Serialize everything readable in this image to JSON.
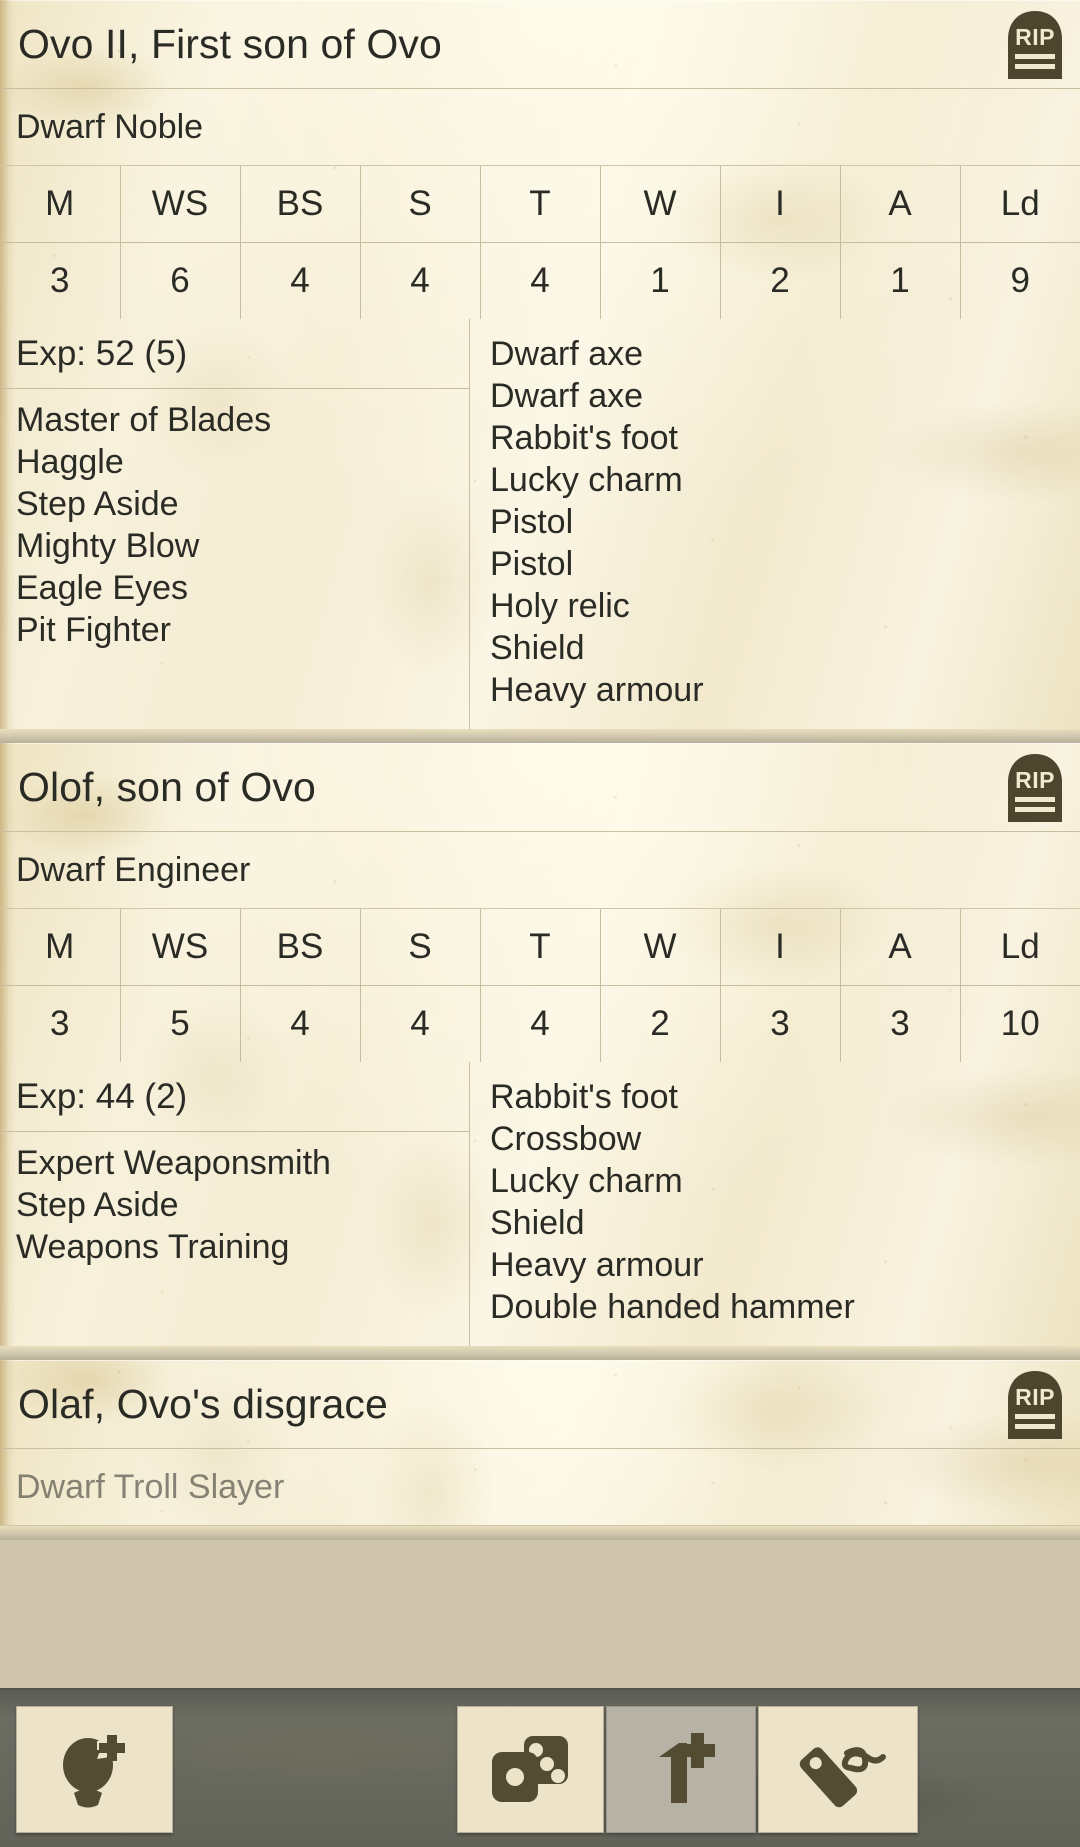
{
  "stat_headers": [
    "M",
    "WS",
    "BS",
    "S",
    "T",
    "W",
    "I",
    "A",
    "Ld"
  ],
  "warriors": [
    {
      "name": "Ovo II, First son of Ovo",
      "type": "Dwarf Noble",
      "status_icon": "rip-tombstone-icon",
      "status_label": "RIP",
      "stats": [
        "3",
        "6",
        "4",
        "4",
        "4",
        "1",
        "2",
        "1",
        "9"
      ],
      "exp": "Exp: 52 (5)",
      "skills": [
        "Master of Blades",
        "Haggle",
        "Step Aside",
        "Mighty Blow",
        "Eagle Eyes",
        "Pit Fighter"
      ],
      "equipment": [
        "Dwarf axe",
        "Dwarf axe",
        "Rabbit's foot",
        "Lucky charm",
        "Pistol",
        "Pistol",
        "Holy relic",
        "Shield",
        "Heavy armour"
      ]
    },
    {
      "name": "Olof, son of Ovo",
      "type": "Dwarf Engineer",
      "status_icon": "rip-tombstone-icon",
      "status_label": "RIP",
      "stats": [
        "3",
        "5",
        "4",
        "4",
        "4",
        "2",
        "3",
        "3",
        "10"
      ],
      "exp": "Exp: 44 (2)",
      "skills": [
        "Expert Weaponsmith",
        "Step Aside",
        "Weapons Training"
      ],
      "equipment": [
        "Rabbit's foot",
        "Crossbow",
        "Lucky charm",
        "Shield",
        "Heavy armour",
        "Double handed hammer"
      ]
    },
    {
      "name": "Olaf, Ovo's disgrace",
      "type": "Dwarf Troll Slayer",
      "status_icon": "rip-tombstone-icon",
      "status_label": "RIP",
      "stats": [],
      "exp": "",
      "skills": [],
      "equipment": []
    }
  ],
  "toolbar": {
    "buttons": [
      {
        "name": "add-warrior-button",
        "icon": "warrior-plus-icon",
        "label": "Add warrior",
        "pressed": false
      },
      {
        "name": "dice-roll-button",
        "icon": "dice-icon",
        "label": "Roll dice",
        "pressed": false
      },
      {
        "name": "advance-button",
        "icon": "one-plus-icon",
        "label": "Advance",
        "pressed": true
      },
      {
        "name": "price-tag-button",
        "icon": "price-tag-icon",
        "label": "Trade",
        "pressed": false
      }
    ]
  },
  "colors": {
    "parchment": "#f3ecd2",
    "ink": "#2b2b26",
    "rule": "#c6bc9e",
    "toolbar_bg": "#6c6d62",
    "button_bg": "#ece3c9",
    "button_pressed_bg": "#b6b2a6",
    "icon_brown": "#544b33"
  }
}
